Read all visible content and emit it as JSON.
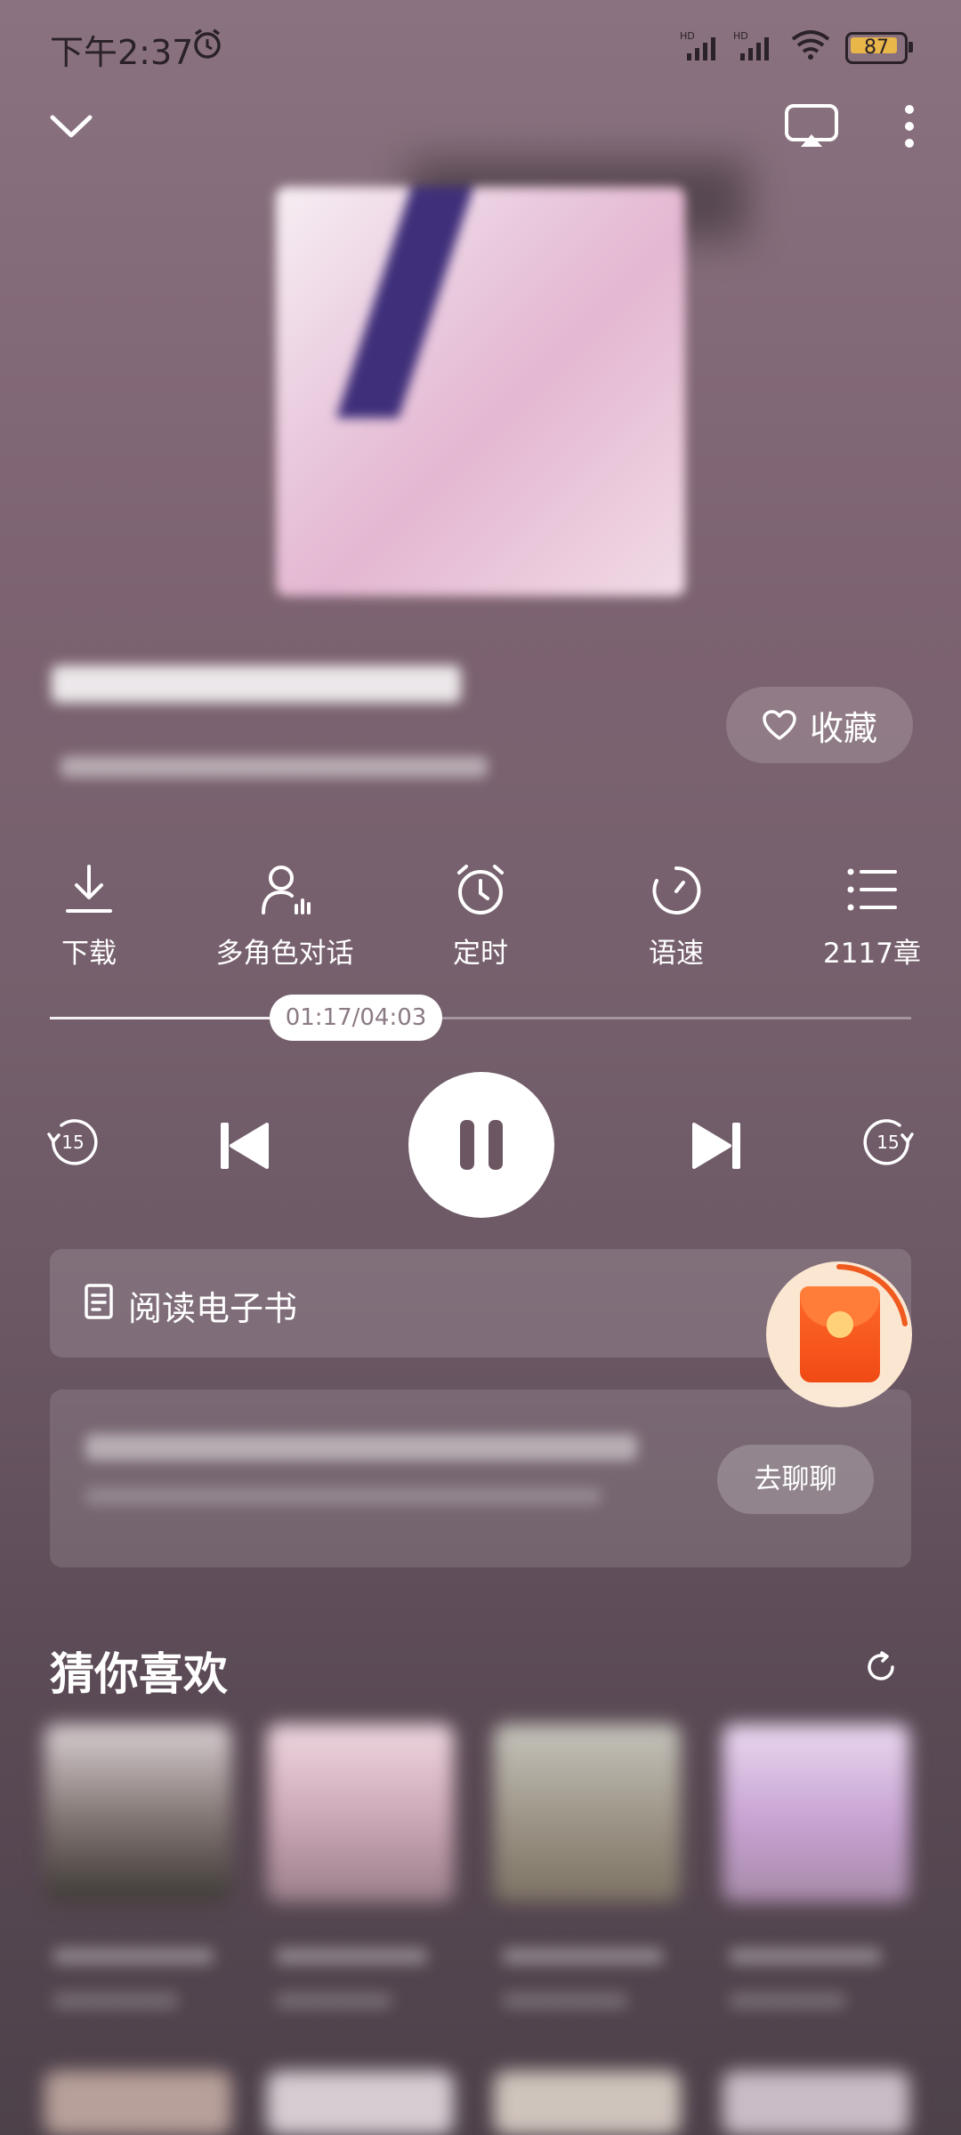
{
  "status_bar": {
    "time": "下午2:37",
    "battery": "87",
    "network_labels": [
      "HD",
      "HD"
    ]
  },
  "header": {
    "collapse_icon": "chevron-down-icon",
    "cast_icon": "cast-icon",
    "more_icon": "more-vertical-icon"
  },
  "book": {
    "favorite_label": "收藏"
  },
  "tools": [
    {
      "label": "下载",
      "icon": "download-icon"
    },
    {
      "label": "多角色对话",
      "icon": "multi-role-icon"
    },
    {
      "label": "定时",
      "icon": "alarm-timer-icon"
    },
    {
      "label": "语速",
      "icon": "speed-icon"
    },
    {
      "label": "2117章",
      "icon": "chapter-list-icon"
    }
  ],
  "player": {
    "time_display": "01:17/04:03",
    "progress_fraction": 0.317,
    "rewind_seconds": "15",
    "forward_seconds": "15"
  },
  "ebook": {
    "label": "阅读电子书"
  },
  "chat": {
    "button_label": "去聊聊"
  },
  "recommend": {
    "title": "猜你喜欢"
  },
  "colors": {
    "accent_red": "#f04a14",
    "background": "#7d6371"
  }
}
